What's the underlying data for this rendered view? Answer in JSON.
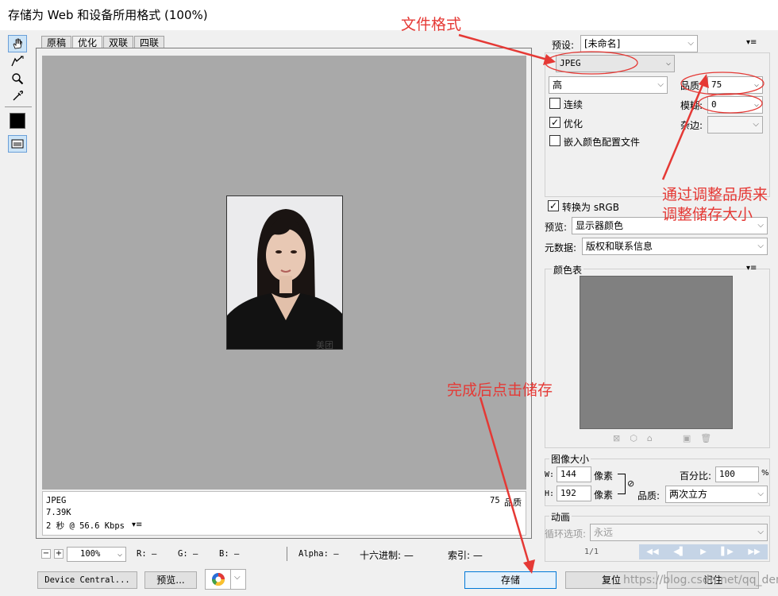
{
  "window": {
    "title": "存储为 Web 和设备所用格式 (100%)"
  },
  "tabs": [
    "原稿",
    "优化",
    "双联",
    "四联"
  ],
  "info": {
    "format": "JPEG",
    "size": "7.39K",
    "time": "2 秒 @ 56.6 Kbps",
    "quality_value": "75",
    "quality_label": "品质"
  },
  "bottom": {
    "zoom": "100%",
    "r": "R: —",
    "g": "G: —",
    "b": "B: —",
    "alpha": "Alpha: —",
    "hex": "十六进制: —",
    "index": "索引: —"
  },
  "buttons": {
    "device": "Device Central...",
    "preview": "预览...",
    "save": "存储",
    "reset": "复位",
    "remember": "记住"
  },
  "preset": {
    "label": "预设:",
    "value": "[未命名]"
  },
  "format": {
    "value": "JPEG"
  },
  "quality_level": {
    "value": "高"
  },
  "quality": {
    "label": "品质:",
    "value": "75"
  },
  "blur": {
    "label": "模糊:",
    "value": "0"
  },
  "matte": {
    "label": "杂边:",
    "value": ""
  },
  "checks": {
    "progressive": "连续",
    "optimized": "优化",
    "embed": "嵌入颜色配置文件",
    "srgb": "转换为 sRGB"
  },
  "preview_sel": {
    "label": "预览:",
    "value": "显示器颜色"
  },
  "metadata": {
    "label": "元数据:",
    "value": "版权和联系信息"
  },
  "color_table": {
    "label": "颜色表"
  },
  "image_size": {
    "label": "图像大小",
    "w_label": "W:",
    "w": "144",
    "h_label": "H:",
    "h": "192",
    "unit": "像素",
    "percent_label": "百分比:",
    "percent": "100",
    "percent_unit": "%",
    "quality_label": "品质:",
    "quality": "两次立方"
  },
  "animation": {
    "label": "动画",
    "loop_label": "循环选项:",
    "loop": "永远",
    "frame": "1/1"
  },
  "annotations": {
    "format": "文件格式",
    "quality_line1": "通过调整品质来",
    "quality_line2": "调整储存大小",
    "save": "完成后点击储存"
  },
  "watermark": {
    "text": "https://blog.csdn.net/qq_demon"
  },
  "photo_mark": "美团",
  "colors": {
    "annotation": "#e53935",
    "viewer_bg": "#a9a9a9",
    "color_table": "#808080"
  }
}
